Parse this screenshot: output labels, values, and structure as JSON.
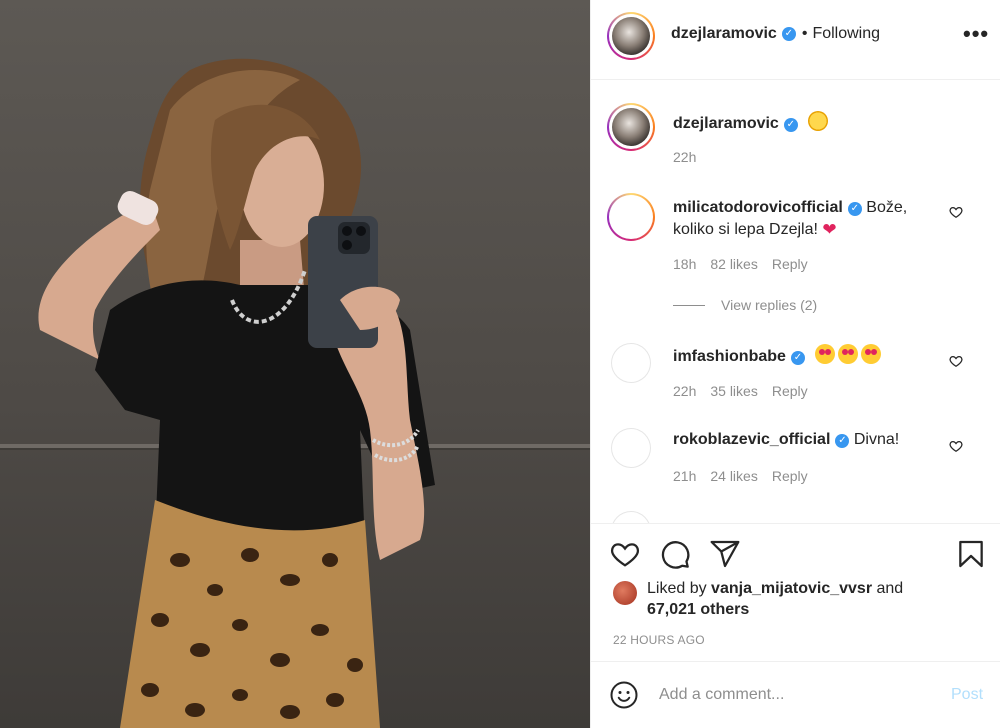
{
  "header": {
    "username": "dzejlaramovic",
    "separator": "•",
    "follow_status": "Following",
    "more_label": "•••"
  },
  "caption": {
    "username": "dzejlaramovic",
    "emoji": "star-struck-emoji",
    "time": "22h"
  },
  "comments": [
    {
      "username": "milicatodorovicofficial",
      "text": "Bože, koliko si lepa Dzejla!",
      "emoji": "❤",
      "time": "18h",
      "likes": "82 likes",
      "reply": "Reply",
      "view_replies": "View replies (2)"
    },
    {
      "username": "imfashionbabe",
      "text": "",
      "emoji": "heart-eyes-emoji x3",
      "time": "22h",
      "likes": "35 likes",
      "reply": "Reply"
    },
    {
      "username": "rokoblazevic_official",
      "text": "Divna!",
      "time": "21h",
      "likes": "24 likes",
      "reply": "Reply"
    }
  ],
  "likes": {
    "prefix": "Liked by",
    "user": "vanja_mijatovic_vvsr",
    "and": "and",
    "count": "67,021 others"
  },
  "timestamp": "22 HOURS AGO",
  "composer": {
    "placeholder": "Add a comment...",
    "post_label": "Post"
  },
  "colors": {
    "verified": "#3897f0",
    "post_disabled": "#b2dffc",
    "muted": "#8e8e8e"
  }
}
